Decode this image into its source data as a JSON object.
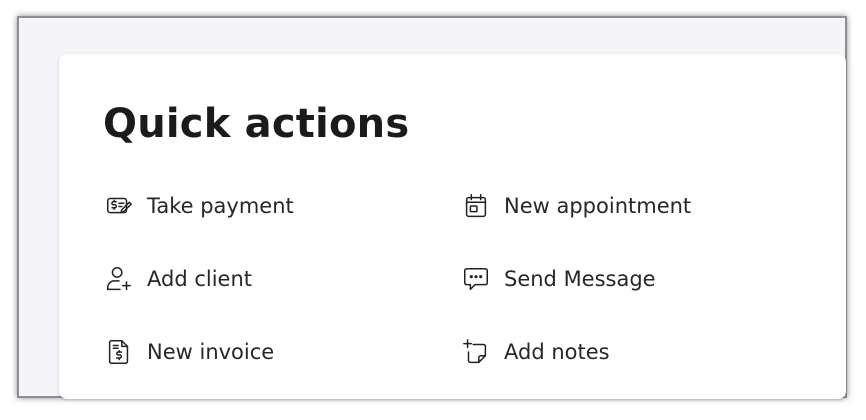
{
  "card": {
    "title": "Quick actions"
  },
  "actions": [
    {
      "label": "Take payment",
      "icon": "payment-icon"
    },
    {
      "label": "New appointment",
      "icon": "calendar-icon"
    },
    {
      "label": "Add client",
      "icon": "add-user-icon"
    },
    {
      "label": "Send Message",
      "icon": "message-icon"
    },
    {
      "label": "New invoice",
      "icon": "invoice-icon"
    },
    {
      "label": "Add notes",
      "icon": "add-note-icon"
    }
  ],
  "colors": {
    "background": "#f4f4f9",
    "card": "#ffffff",
    "text": "#1b1b1b"
  }
}
